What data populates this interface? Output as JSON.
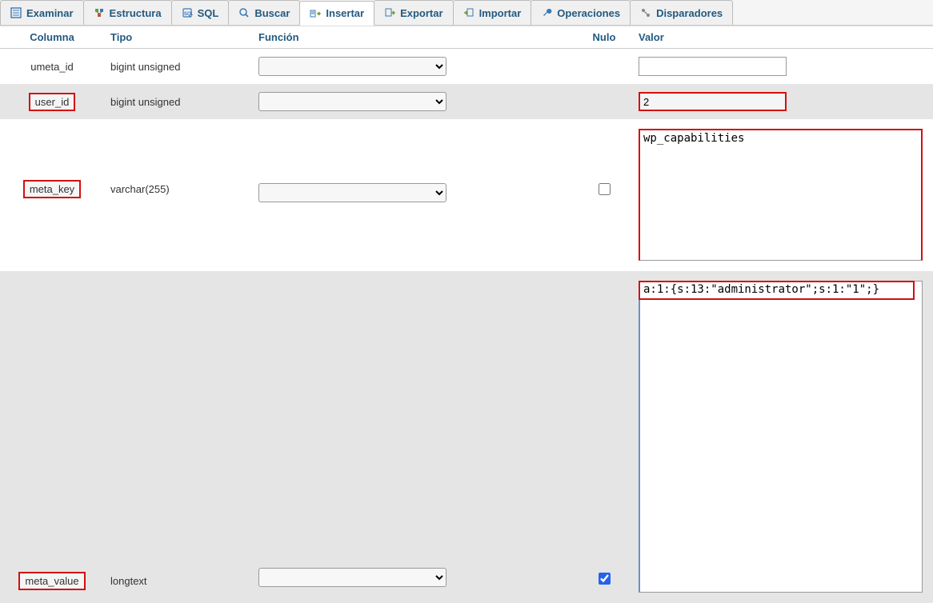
{
  "tabs": [
    {
      "name": "examinar",
      "label": "Examinar"
    },
    {
      "name": "estructura",
      "label": "Estructura"
    },
    {
      "name": "sql",
      "label": "SQL"
    },
    {
      "name": "buscar",
      "label": "Buscar"
    },
    {
      "name": "insertar",
      "label": "Insertar"
    },
    {
      "name": "exportar",
      "label": "Exportar"
    },
    {
      "name": "importar",
      "label": "Importar"
    },
    {
      "name": "operaciones",
      "label": "Operaciones"
    },
    {
      "name": "disparadores",
      "label": "Disparadores"
    }
  ],
  "active_tab": "insertar",
  "headers": {
    "columna": "Columna",
    "tipo": "Tipo",
    "funcion": "Función",
    "nulo": "Nulo",
    "valor": "Valor"
  },
  "rows": [
    {
      "col": "umeta_id",
      "type": "bigint unsigned",
      "fn": "",
      "null": null,
      "value": "",
      "highlight": false
    },
    {
      "col": "user_id",
      "type": "bigint unsigned",
      "fn": "",
      "null": null,
      "value": "2",
      "highlight": true
    },
    {
      "col": "meta_key",
      "type": "varchar(255)",
      "fn": "",
      "null": false,
      "value": "wp_capabilities",
      "highlight": true,
      "textarea": true,
      "spell": [
        "wp",
        "capabilities"
      ]
    },
    {
      "col": "meta_value",
      "type": "longtext",
      "fn": "",
      "null": true,
      "value": "a:1:{s:13:\"administrator\";s:1:\"1\";}",
      "highlight": true,
      "textarea": true,
      "big": true
    }
  ]
}
